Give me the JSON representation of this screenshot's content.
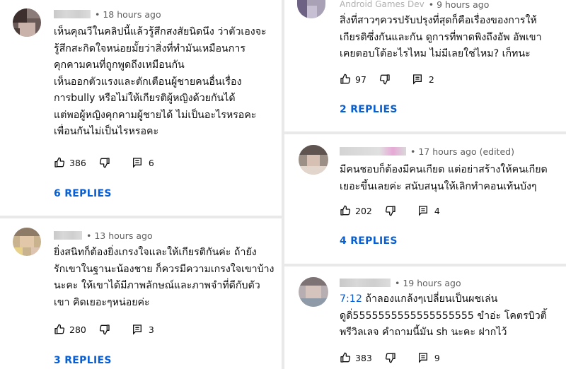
{
  "comments": [
    {
      "author_time": "18 hours ago",
      "body": "เห็นคุณวีในคลิปนี้แล้วรู้สึกสงสัยนิดนึง ว่าตัวเองจะ\nรู้สึกสะกิดใจหน่อยมั้ยว่าสิ่งที่ทำมันเหมือนการ\nคุกคามคนที่ถูกพูดถึงเหมือนกัน\nเห็นออกตัวแรงและตักเตือนผู้ชายคนอื่นเรื่อง\nการbully หรือไม่ให้เกียรติผู้หญิงด้วยกันได้\nแต่พอผู้หญิงคุกคามผู้ชายได้ ไม่เป็นอะไรหรอคะ\nเพื่อนกันไม่เป็นไรหรอคะ",
      "likes": "386",
      "reply_count": "6",
      "replies_label": "6 REPLIES"
    },
    {
      "author_time": "13 hours ago",
      "body": "ยิ่งสนิทก็ต้องยิ่งเกรงใจและให้เกียรติกันค่ะ ถ้ายัง\nรักเขาในฐานะน้องชาย ก็ควรมีความเกรงใจเขาบ้าง\nนะคะ ให้เขาได้มีภาพลักษณ์และภาพจำที่ดีกับตัว\nเขา คิดเยอะๆหน่อยค่ะ",
      "likes": "280",
      "reply_count": "3",
      "replies_label": "3 REPLIES"
    },
    {
      "author_name_partial": "Android Games Dev",
      "author_time": "9 hours ago",
      "body": "สิ่งที่สาวๆควรปรับปรุงที่สุดก็คือเรื่องของการให้\nเกียรติซึ่งกันและกัน ดูการที่พาดพิงถึงอัพ อัพเขา\nเคยตอบโต้อะไรไหม ไม่มีเลยใช่ไหม? เก็ทนะ",
      "likes": "97",
      "reply_count": "2",
      "replies_label": "2 REPLIES"
    },
    {
      "author_time": "17 hours ago (edited)",
      "body": "มีคนชอบก็ต้องมีคนเกียด แต่อย่าสร้างให้คนเกียด\nเยอะขึ้นเลยค่ะ สนับสนุนให้เลิกทำคอนเท้นบังๆ",
      "likes": "202",
      "reply_count": "4",
      "replies_label": "4 REPLIES"
    },
    {
      "author_time": "19 hours ago",
      "timestamp_link": "7:12",
      "body_first": " ถ้าลองแกล้งๆเปลี่ยนเป็นผชเล่น",
      "body_rest": "ดูดิ่5555555555555555555 ขำอ่ะ โคตรบิวติ้\nพรีวิลเลจ คำถามนี้มัน sh นะคะ ฝากไว้",
      "likes": "383",
      "reply_count": "9"
    }
  ],
  "colors": {
    "link": "#065fd4",
    "meta": "#606060",
    "divider": "#e9e9e9"
  },
  "icons": [
    "thumbs-up-icon",
    "thumbs-down-icon",
    "comment-reply-icon"
  ]
}
